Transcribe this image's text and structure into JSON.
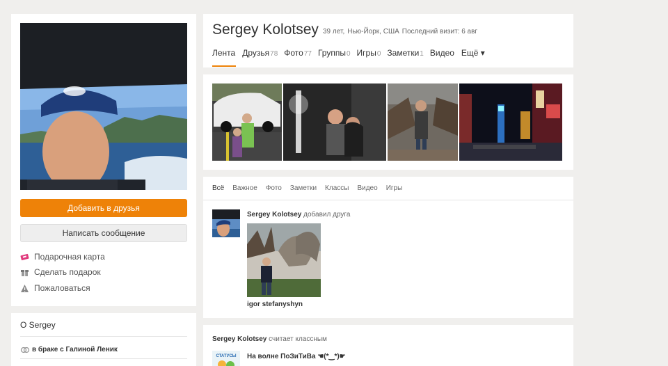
{
  "profile": {
    "name": "Sergey Kolotsey",
    "age": "39 лет,",
    "location": "Нью-Йорк, США",
    "last_visit": "Последний визит: 6 авг"
  },
  "nav": [
    {
      "label": "Лента",
      "count": ""
    },
    {
      "label": "Друзья",
      "count": "78"
    },
    {
      "label": "Фото",
      "count": "77"
    },
    {
      "label": "Группы",
      "count": "0"
    },
    {
      "label": "Игры",
      "count": "0"
    },
    {
      "label": "Заметки",
      "count": "1"
    },
    {
      "label": "Видео",
      "count": ""
    },
    {
      "label": "Ещё ▾",
      "count": ""
    }
  ],
  "actions": {
    "add_friend": "Добавить в друзья",
    "send_message": "Написать сообщение",
    "gift_card": "Подарочная карта",
    "make_gift": "Сделать подарок",
    "report": "Пожаловаться"
  },
  "about": {
    "title": "О Sergey",
    "married": "в браке с Галиной Леник"
  },
  "feed": {
    "tabs": [
      "Всё",
      "Важное",
      "Фото",
      "Заметки",
      "Классы",
      "Видео",
      "Игры"
    ],
    "post1": {
      "author": "Sergey Kolotsey",
      "action": "добавил друга",
      "friend_name": "igor stefanyshyn"
    },
    "post2": {
      "author": "Sergey Kolotsey",
      "action": "считает классным",
      "group": "На волне ПоЗиТиВа ☚(*‿*)☛",
      "thumb_text": "СТАТУСЫ"
    }
  },
  "colors": {
    "accent": "#ee8208",
    "background": "#f0efed"
  },
  "icons": {
    "gift_card": "gift-card-icon",
    "make_gift": "gift-icon",
    "report": "warning-icon",
    "married": "rings-icon"
  }
}
